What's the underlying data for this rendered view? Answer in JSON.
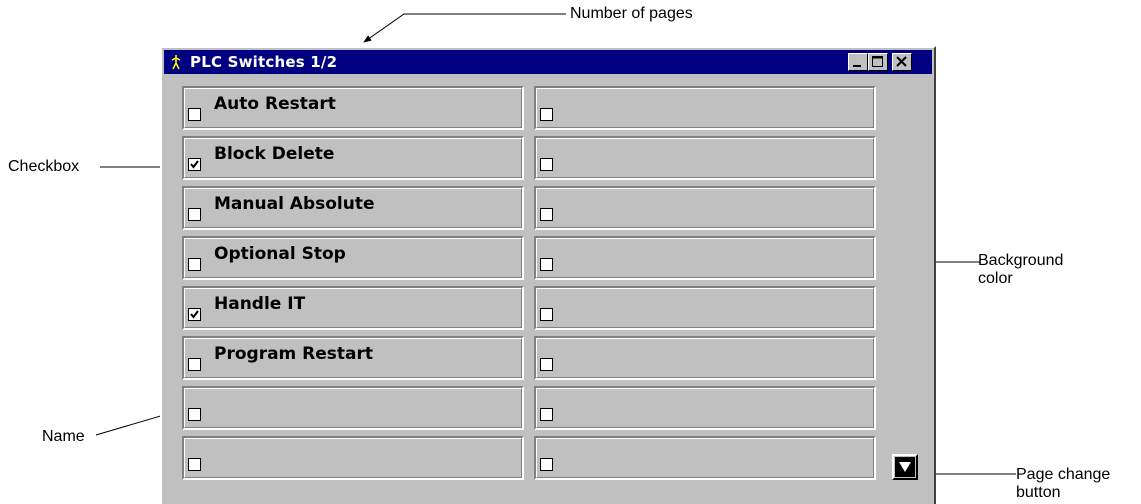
{
  "window": {
    "title": "PLC Switches 1/2",
    "titlebar_color": "#000080",
    "background_color": "#c0c0c0",
    "controls": [
      "minimize-icon",
      "maximize-icon",
      "close-icon"
    ]
  },
  "switches": {
    "left": [
      {
        "label": "Auto Restart",
        "checked": false
      },
      {
        "label": "Block Delete",
        "checked": true
      },
      {
        "label": "Manual Absolute",
        "checked": false
      },
      {
        "label": "Optional Stop",
        "checked": false
      },
      {
        "label": "Handle IT",
        "checked": true
      },
      {
        "label": "Program Restart",
        "checked": false
      },
      {
        "label": "",
        "checked": false
      },
      {
        "label": "",
        "checked": false
      }
    ],
    "right": [
      {
        "label": "",
        "checked": false
      },
      {
        "label": "",
        "checked": false
      },
      {
        "label": "",
        "checked": false
      },
      {
        "label": "",
        "checked": false
      },
      {
        "label": "",
        "checked": false
      },
      {
        "label": "",
        "checked": false
      },
      {
        "label": "",
        "checked": false
      },
      {
        "label": "",
        "checked": false
      }
    ]
  },
  "page_change_button": {
    "icon": "triangle-down-icon"
  },
  "callouts": {
    "number_of_pages": "Number of pages",
    "checkbox": "Checkbox",
    "background_color": "Background color",
    "name": "Name",
    "page_change_button": "Page change button"
  }
}
